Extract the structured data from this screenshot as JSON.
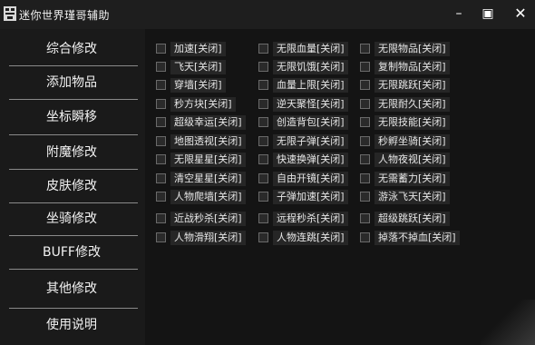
{
  "window": {
    "title": "迷你世界瑾哥辅助",
    "app_icon": "app-logo-icon",
    "controls": {
      "minimize": "–",
      "maximize": "▣",
      "close": "✕"
    }
  },
  "sidebar": {
    "items": [
      {
        "label": "综合修改"
      },
      {
        "label": "添加物品"
      },
      {
        "label": "坐标瞬移"
      },
      {
        "label": "附魔修改"
      },
      {
        "label": "皮肤修改"
      },
      {
        "label": "坐骑修改"
      },
      {
        "label": "BUFF修改"
      },
      {
        "label": "其他修改"
      },
      {
        "label": "使用说明"
      }
    ]
  },
  "options": {
    "col1": [
      {
        "label": "加速[关闭]",
        "checked": false
      },
      {
        "label": "飞天[关闭]",
        "checked": false
      },
      {
        "label": "穿墙[关闭]",
        "checked": false
      },
      {
        "label": "秒方块[关闭]",
        "checked": false
      },
      {
        "label": "超级幸运[关闭]",
        "checked": false
      },
      {
        "label": "地图透视[关闭]",
        "checked": false
      },
      {
        "label": "无限星星[关闭]",
        "checked": false
      },
      {
        "label": "清空星星[关闭]",
        "checked": false
      },
      {
        "label": "人物爬墙[关闭]",
        "checked": false
      },
      {
        "label": "近战秒杀[关闭]",
        "checked": false
      },
      {
        "label": "人物滑翔[关闭]",
        "checked": false
      }
    ],
    "col2": [
      {
        "label": "无限血量[关闭]",
        "checked": false
      },
      {
        "label": "无限饥饿[关闭]",
        "checked": false
      },
      {
        "label": "血量上限[关闭]",
        "checked": false
      },
      {
        "label": "逆天聚怪[关闭]",
        "checked": false
      },
      {
        "label": "创造背包[关闭]",
        "checked": false
      },
      {
        "label": "无限子弹[关闭]",
        "checked": false
      },
      {
        "label": "快速换弹[关闭]",
        "checked": false
      },
      {
        "label": "自由开镜[关闭]",
        "checked": false
      },
      {
        "label": "子弹加速[关闭]",
        "checked": false
      },
      {
        "label": "远程秒杀[关闭]",
        "checked": false
      },
      {
        "label": "人物连跳[关闭]",
        "checked": false
      }
    ],
    "col3": [
      {
        "label": "无限物品[关闭]",
        "checked": false
      },
      {
        "label": "复制物品[关闭]",
        "checked": false
      },
      {
        "label": "无限跳跃[关闭]",
        "checked": false
      },
      {
        "label": "无限耐久[关闭]",
        "checked": false
      },
      {
        "label": "无限技能[关闭]",
        "checked": false
      },
      {
        "label": "秒孵坐骑[关闭]",
        "checked": false
      },
      {
        "label": "人物夜视[关闭]",
        "checked": false
      },
      {
        "label": "无需蓄力[关闭]",
        "checked": false
      },
      {
        "label": "游泳飞天[关闭]",
        "checked": false
      },
      {
        "label": "超级跳跃[关闭]",
        "checked": false
      },
      {
        "label": "掉落不掉血[关闭]",
        "checked": false
      }
    ]
  }
}
